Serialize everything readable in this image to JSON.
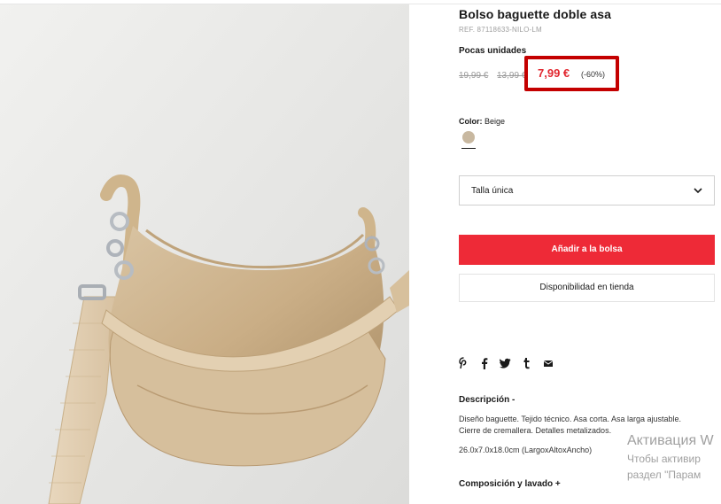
{
  "product": {
    "title": "Bolso baguette doble asa",
    "ref": "REF. 87118633-NILO-LM",
    "stock_label": "Pocas unidades",
    "price_original_1": "19,99 €",
    "price_original_2": "13,99 €",
    "price_current": "7,99 €",
    "discount": "(-60%)",
    "color_label": "Color:",
    "color_value": "Beige",
    "swatch_color": "#c8b8a0",
    "size_label": "Talla única",
    "add_to_bag": "Añadir a la bolsa",
    "store_availability": "Disponibilidad en tienda"
  },
  "share": {
    "icons": [
      "pinterest-icon",
      "facebook-icon",
      "twitter-icon",
      "tumblr-icon",
      "email-icon"
    ]
  },
  "description": {
    "title": "Descripción  -",
    "body": "Diseño baguette. Tejido técnico. Asa corta. Asa larga ajustable. Cierre de cremallera. Detalles metalizados.",
    "dimensions": "26.0x7.0x18.0cm (LargoxAltoxAncho)",
    "composition_title": "Composición y lavado  +"
  },
  "os_overlay": {
    "line1": "Активация W",
    "line2": "Чтобы активир",
    "line3": "раздел \"Парам"
  },
  "colors": {
    "accent_red": "#ee2a37",
    "price_red": "#e1272f",
    "highlight_box": "#c40000"
  }
}
